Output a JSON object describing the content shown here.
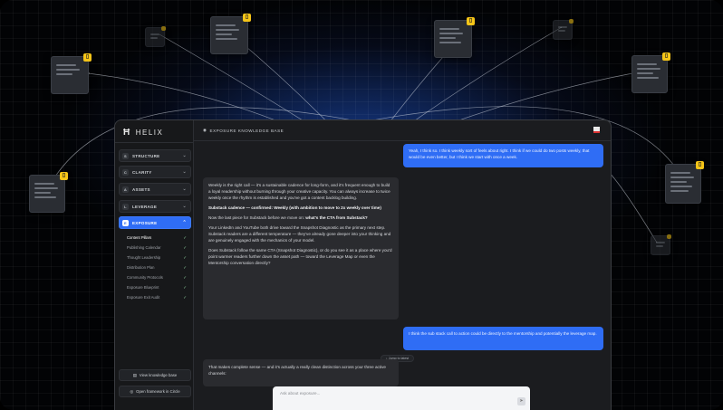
{
  "app": {
    "name": "HELIX"
  },
  "header": {
    "title": "EXPOSURE KNOWLEDGE BASE"
  },
  "sidebar": {
    "sections": [
      {
        "badge": "S",
        "label": "STRUCTURE"
      },
      {
        "badge": "C",
        "label": "CLARITY"
      },
      {
        "badge": "A",
        "label": "ASSETS"
      },
      {
        "badge": "L",
        "label": "LEVERAGE"
      },
      {
        "badge": "E",
        "label": "EXPOSURE"
      }
    ],
    "subitems": [
      "Content Pillars",
      "Publishing Calendar",
      "Thought Leadership",
      "Distribution Plan",
      "Community Protocols",
      "Exposure Blueprint",
      "Exposure Exit Audit"
    ],
    "buttons": {
      "knowledge": "View knowledge base",
      "circle": "Open framework in Circle"
    }
  },
  "chat": {
    "user1": "Yeah, I think so. I think weekly sort of feels about right. I think if we could do two posts weekly, that would be even better, but I think we start with once a week.",
    "ai1": {
      "p1": "Weekly is the right call — it's a sustainable cadence for long-form, and it's frequent enough to build a loyal readership without burning through your creative capacity. You can always increase to twice weekly once the rhythm is established and you've got a content backlog building.",
      "p2": "Substack cadence — confirmed: Weekly (with ambition to move to 2x weekly over time)",
      "p3a": "Now the last piece for Substack before we move on: ",
      "p3b": "what's the CTA from Substack?",
      "p4": "Your LinkedIn and YouTube both drive toward the Snapshot Diagnostic as the primary next step. Substack readers are a different temperature — they've already gone deeper into your thinking and are genuinely engaged with the mechanics of your model.",
      "p5": "Does Substack follow the same CTA (Snapshot Diagnostic), or do you see it as a place where you'd point warmer readers further down the asset path — toward the Leverage Map or even the Mentorship conversation directly?"
    },
    "user2": "I think the sub stack call to action could be directly to the mentorship and potentially the leverage map.",
    "ai2": "That makes complete sense — and it's actually a really clean distinction across your three active channels:",
    "jump": "Jump to latest"
  },
  "input": {
    "placeholder": "Ask about exposure..."
  },
  "icons": [
    "helix-logo-icon",
    "book-icon",
    "circle-icon",
    "chevron-down-icon",
    "check-icon",
    "send-icon",
    "flag-icon",
    "document-icon"
  ]
}
